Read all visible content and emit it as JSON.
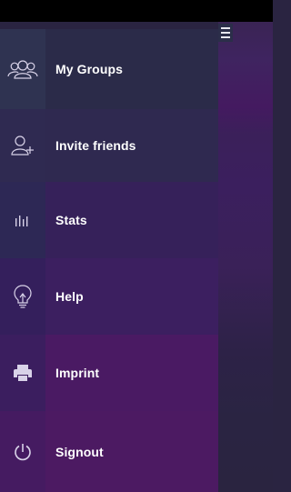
{
  "colors": {
    "status_bar": "#000000",
    "label_text": "#ffffff",
    "icon_stroke": "#d8d2e8",
    "menu_rows": [
      "#2b2b49",
      "#2f2950",
      "#36215a",
      "#3c1f60",
      "#4a1a63",
      "#4c1a62"
    ]
  },
  "menu": {
    "items": [
      {
        "label": "My Groups",
        "icon": "group-icon"
      },
      {
        "label": "Invite friends",
        "icon": "add-user-icon"
      },
      {
        "label": "Stats",
        "icon": "bar-chart-icon"
      },
      {
        "label": "Help",
        "icon": "lightbulb-icon"
      },
      {
        "label": "Imprint",
        "icon": "printer-icon"
      },
      {
        "label": "Signout",
        "icon": "power-icon"
      }
    ]
  },
  "toolbar": {
    "menu_toggle_icon": "hamburger-icon"
  }
}
